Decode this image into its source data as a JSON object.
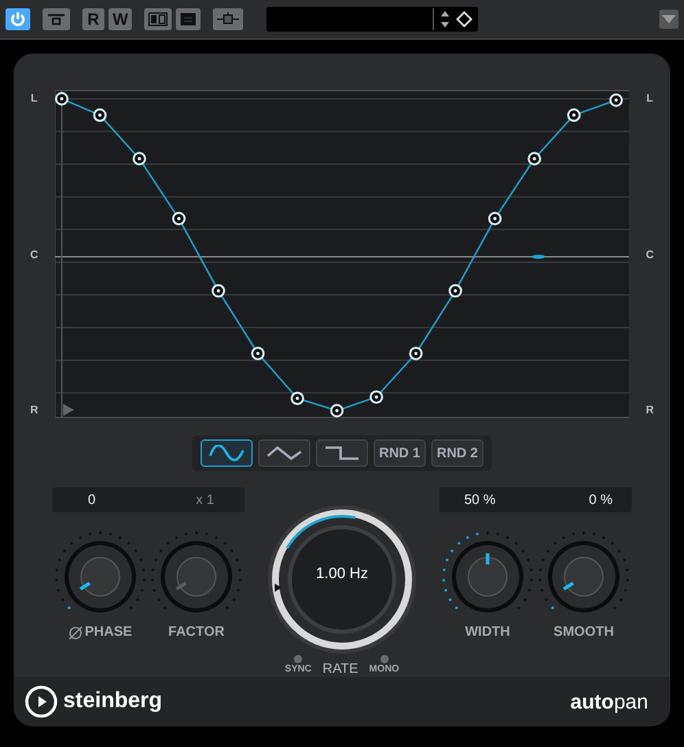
{
  "toolbar": {
    "buttons": [
      {
        "kind": "power",
        "on": true
      },
      {
        "kind": "bypass",
        "on": false
      },
      {
        "kind": "text",
        "label": "R",
        "on": false
      },
      {
        "kind": "text",
        "label": "W",
        "on": false
      },
      {
        "kind": "compare",
        "on": false
      },
      {
        "kind": "settings",
        "on": false
      },
      {
        "kind": "sidechain",
        "on": false
      }
    ]
  },
  "graph": {
    "left_labels": [
      "L",
      "C",
      "R"
    ],
    "right_labels": [
      "L",
      "C",
      "R"
    ]
  },
  "waveforms": [
    {
      "kind": "sine",
      "selected": true
    },
    {
      "kind": "triangle",
      "selected": false
    },
    {
      "kind": "square",
      "selected": false
    },
    {
      "kind": "text",
      "label": "RND 1",
      "selected": false
    },
    {
      "kind": "text",
      "label": "RND 2",
      "selected": false
    }
  ],
  "left_display": [
    {
      "text": "0",
      "disabled": false
    },
    {
      "text": "x 1",
      "disabled": true
    }
  ],
  "right_display": [
    {
      "text": "50 %",
      "disabled": false
    },
    {
      "text": "0 %",
      "disabled": false
    }
  ],
  "left_knobs": [
    {
      "label": "PHASE",
      "invert_icon": true,
      "level": 0.05,
      "disabled": false
    },
    {
      "label": "FACTOR",
      "invert_icon": false,
      "level": 0.05,
      "disabled": true
    }
  ],
  "right_knobs": [
    {
      "label": "WIDTH",
      "invert_icon": false,
      "level": 0.5,
      "disabled": false
    },
    {
      "label": "SMOOTH",
      "invert_icon": false,
      "level": 0.05,
      "disabled": false
    }
  ],
  "rate": {
    "value": "1.00 Hz",
    "label": "RATE",
    "level": 0.3,
    "sync": {
      "label": "SYNC",
      "on": false
    },
    "mono": {
      "label": "MONO",
      "on": false
    }
  },
  "footer": {
    "brand": "steinberg",
    "product": "**auto**pan"
  }
}
